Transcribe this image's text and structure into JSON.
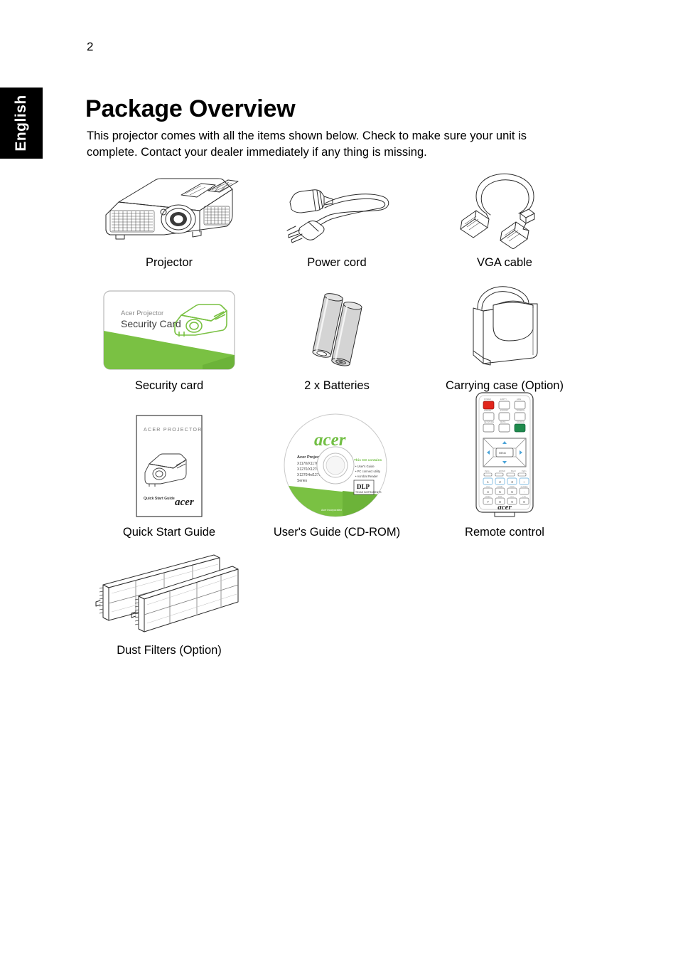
{
  "sidebar": {
    "language_tab": "English"
  },
  "header": {
    "page_number": "2",
    "title": "Package Overview",
    "intro": "This projector comes with all the items shown below. Check to make sure your unit is complete. Contact your dealer immediately if any thing is missing."
  },
  "colors": {
    "acer_green": "#72bf44",
    "card_green": "#7ac143",
    "remote_red": "#e1251b",
    "remote_green": "#1f8a4c",
    "line": "#2b2b2b",
    "tab_background": "#000000"
  },
  "items": [
    {
      "id": "projector",
      "icon": "projector-icon",
      "label": "Projector"
    },
    {
      "id": "power-cord",
      "icon": "power-cord-icon",
      "label": "Power cord"
    },
    {
      "id": "vga-cable",
      "icon": "vga-cable-icon",
      "label": "VGA cable"
    },
    {
      "id": "security-card",
      "icon": "security-card-icon",
      "label": "Security card"
    },
    {
      "id": "batteries",
      "icon": "batteries-icon",
      "label": "2 x Batteries"
    },
    {
      "id": "carrying-case",
      "icon": "carrying-case-icon",
      "label": "Carrying case (Option)"
    },
    {
      "id": "quick-start-guide",
      "icon": "booklet-icon",
      "label": "Quick Start Guide"
    },
    {
      "id": "users-guide-cd",
      "icon": "cd-rom-icon",
      "label": "User's Guide (CD-ROM)"
    },
    {
      "id": "remote-control",
      "icon": "remote-control-icon",
      "label": "Remote control"
    },
    {
      "id": "dust-filters",
      "icon": "dust-filter-icon",
      "label": "Dust Filters (Option)"
    }
  ],
  "artwork_text": {
    "security_card": {
      "line1": "Acer Projector",
      "line2": "Security Card"
    },
    "quick_start_guide": {
      "heading": "ACER PROJECTOR",
      "footer": "Quick Start Guide",
      "brand": "acer"
    },
    "cd_rom": {
      "brand": "acer",
      "title": "Acer Projector",
      "models_1": "X1170/X1170N/X1170A/",
      "models_2": "X1270/X1270N/",
      "models_3": "X1270Hn/1270n",
      "models_4": "Series",
      "contents_heading": "This CD contains",
      "contents_1": "User's Guide",
      "contents_2": "PC connect utility",
      "contents_3": "Acrobat Reader",
      "logo": "DLP"
    },
    "remote_control": {
      "brand": "acer"
    }
  }
}
